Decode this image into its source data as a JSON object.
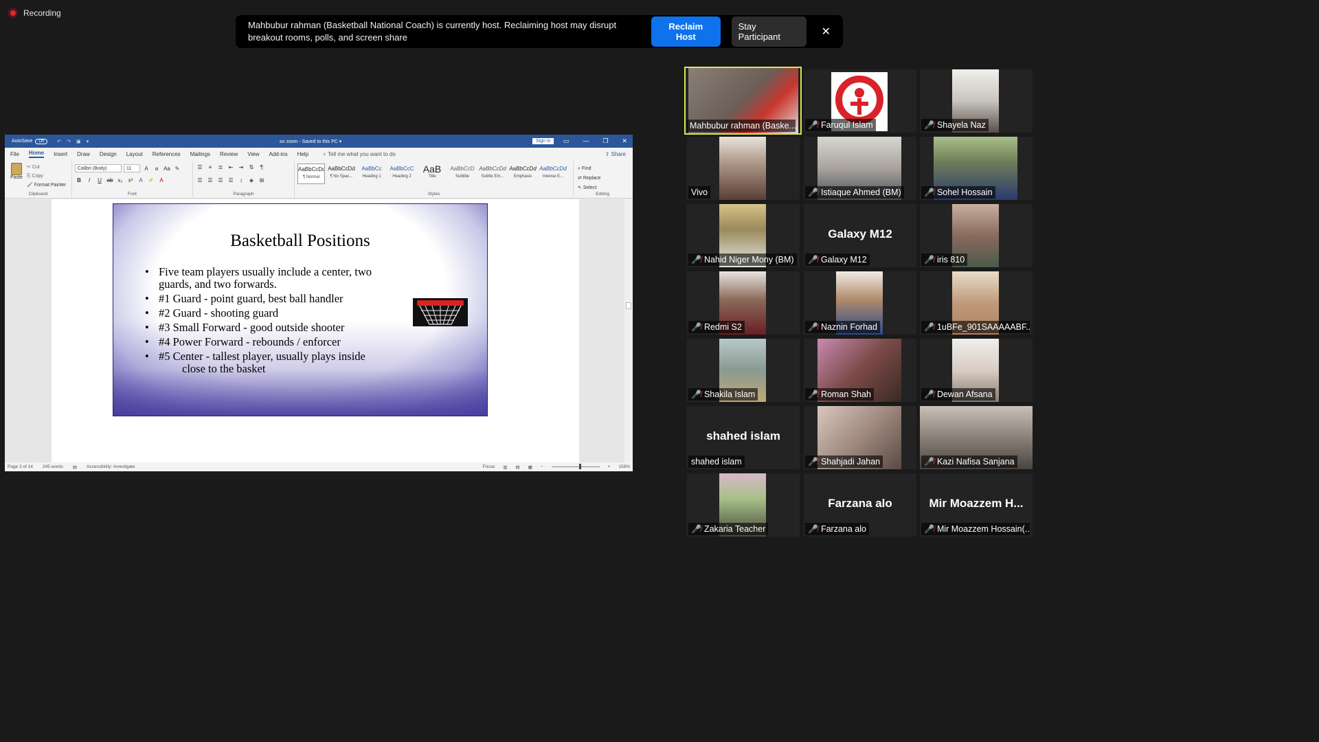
{
  "recording": {
    "label": "Recording"
  },
  "banner": {
    "message": "Mahbubur rahman (Basketball National Coach) is currently host. Reclaiming host may disrupt breakout rooms, polls, and screen share",
    "reclaim_label": "Reclaim Host",
    "stay_label": "Stay Participant",
    "close_glyph": "✕"
  },
  "word": {
    "autosave": "AutoSave",
    "autosave_state": "Off",
    "doc_title": "so zoom  -  Saved to this PC  ▾",
    "signin": "Sign in",
    "tabs": [
      "File",
      "Home",
      "Insert",
      "Draw",
      "Design",
      "Layout",
      "References",
      "Mailings",
      "Review",
      "View",
      "Add-ins",
      "Help"
    ],
    "tell_me": "Tell me what you want to do",
    "share": "Share",
    "clipboard": {
      "paste": "Paste",
      "cut": "Cut",
      "copy": "Copy",
      "format_painter": "Format Painter",
      "label": "Clipboard"
    },
    "font": {
      "name": "Calibri (Body)",
      "size": "11",
      "label": "Font"
    },
    "paragraph": {
      "label": "Paragraph"
    },
    "styles": {
      "label": "Styles",
      "items": [
        {
          "sample": "AaBbCcDd",
          "name": "¶ Normal"
        },
        {
          "sample": "AaBbCcDd",
          "name": "¶ No Spac..."
        },
        {
          "sample": "AaBbCc",
          "name": "Heading 1"
        },
        {
          "sample": "AaBbCcC",
          "name": "Heading 2"
        },
        {
          "sample": "AaB",
          "name": "Title"
        },
        {
          "sample": "AaBbCcD",
          "name": "Subtitle"
        },
        {
          "sample": "AaBbCcDd",
          "name": "Subtle Em..."
        },
        {
          "sample": "AaBbCcDd",
          "name": "Emphasis"
        },
        {
          "sample": "AaBbCcDd",
          "name": "Intense E..."
        }
      ]
    },
    "editing": {
      "find": "Find",
      "replace": "Replace",
      "select": "Select",
      "label": "Editing"
    },
    "status": {
      "page": "Page 3 of 14",
      "words": "245 words",
      "accessibility": "Accessibility: Investigate",
      "focus": "Focus",
      "zoom": "158%"
    }
  },
  "slide": {
    "title": "Basketball Positions",
    "bullets": [
      {
        "line": "Five team players usually include a center, two",
        "cont": "guards, and two forwards."
      },
      {
        "line": "#1 Guard - point guard, best ball handler",
        "cont": ""
      },
      {
        "line": "#2 Guard - shooting guard",
        "cont": ""
      },
      {
        "line": "#3 Small Forward - good outside shooter",
        "cont": ""
      },
      {
        "line": "#4 Power Forward - rebounds / enforcer",
        "cont": ""
      },
      {
        "line": "#5 Center - tallest player, usually plays inside",
        "cont": "close to the basket"
      }
    ]
  },
  "participants": [
    {
      "name": "Mahbubur rahman (Baske...",
      "muted": false,
      "video": true,
      "active": true,
      "color": "#7a6e66"
    },
    {
      "name": "Faruqul Islam",
      "muted": true,
      "video": true,
      "active": false,
      "color": "#f2f2f2"
    },
    {
      "name": "Shayela Naz",
      "muted": true,
      "video": true,
      "active": false,
      "color": "#8a7f74"
    },
    {
      "name": "Vivo",
      "muted": false,
      "video": true,
      "active": false,
      "color": "#6e5c52"
    },
    {
      "name": "Istiaque Ahmed (BM)",
      "muted": true,
      "video": true,
      "active": false,
      "color": "#9a9488"
    },
    {
      "name": "Sohel Hossain",
      "muted": true,
      "video": true,
      "active": false,
      "color": "#5e6f4a"
    },
    {
      "name": "Nahid Niger Mony (BM)",
      "muted": true,
      "video": true,
      "active": false,
      "color": "#9c8a5a"
    },
    {
      "name": "Galaxy M12",
      "muted": true,
      "video": false,
      "active": false,
      "big": "Galaxy M12"
    },
    {
      "name": "iris 810",
      "muted": true,
      "video": true,
      "active": false,
      "color": "#8c6a5e"
    },
    {
      "name": "Redmi S2",
      "muted": true,
      "video": true,
      "active": false,
      "color": "#6c5148"
    },
    {
      "name": "Naznin Forhad",
      "muted": true,
      "video": true,
      "active": false,
      "color": "#a08a6e"
    },
    {
      "name": "1uBFe_901SAAAAABF...",
      "muted": true,
      "video": true,
      "active": false,
      "color": "#b09a86"
    },
    {
      "name": "Shakila Islam",
      "muted": true,
      "video": true,
      "active": false,
      "color": "#8fa0a0"
    },
    {
      "name": "Roman Shah",
      "muted": true,
      "video": true,
      "active": false,
      "color": "#6a4a44"
    },
    {
      "name": "Dewan Afsana",
      "muted": true,
      "video": true,
      "active": false,
      "color": "#c8c0ba"
    },
    {
      "name": "shahed islam",
      "muted": false,
      "video": false,
      "active": false,
      "big": "shahed islam"
    },
    {
      "name": "Shahjadi Jahan",
      "muted": true,
      "video": true,
      "active": false,
      "color": "#9a8a80"
    },
    {
      "name": "Kazi Nafisa Sanjana",
      "muted": true,
      "video": true,
      "active": false,
      "color": "#8c8078"
    },
    {
      "name": "Zakaria Teacher",
      "muted": true,
      "video": true,
      "active": false,
      "color": "#8a9a7a"
    },
    {
      "name": "Farzana alo",
      "muted": true,
      "video": false,
      "active": false,
      "big": "Farzana alo"
    },
    {
      "name": "Mir Moazzem Hossain(...",
      "muted": true,
      "video": false,
      "active": false,
      "big": "Mir Moazzem H..."
    }
  ]
}
